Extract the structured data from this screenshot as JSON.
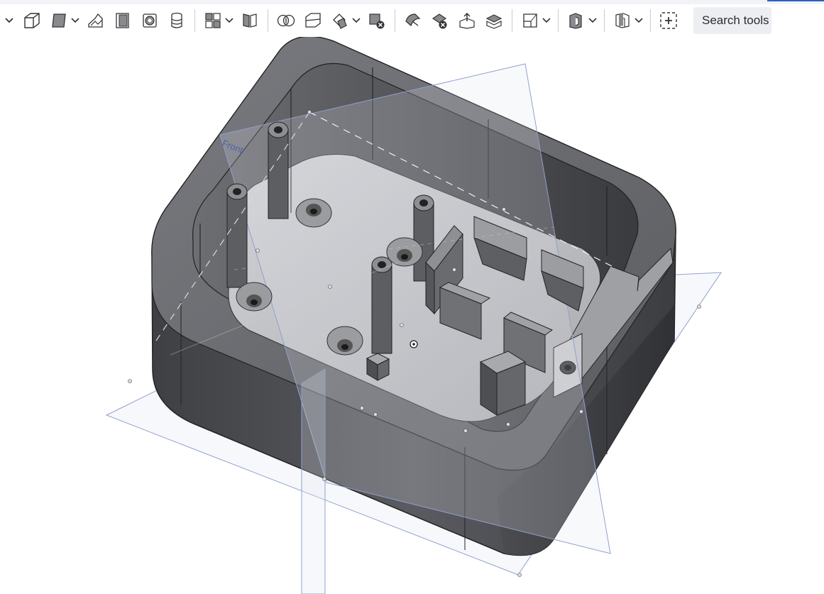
{
  "toolbar": {
    "tools": [
      {
        "icon": "chevron-down-icon"
      },
      {
        "icon": "extrude-icon"
      },
      {
        "icon": "revolve-icon",
        "has_dropdown": true
      },
      {
        "icon": "sweep-icon"
      },
      {
        "icon": "loft-icon"
      },
      {
        "icon": "thicken-icon"
      },
      {
        "icon": "enclose-icon"
      },
      {
        "icon": "fillet-icon",
        "has_dropdown": true
      },
      {
        "icon": "chamfer-icon"
      },
      {
        "icon": "boolean-icon"
      },
      {
        "icon": "split-icon"
      },
      {
        "icon": "transform-icon",
        "has_dropdown": true
      },
      {
        "icon": "delete-part-icon"
      },
      {
        "icon": "modify-fillet-icon"
      },
      {
        "icon": "delete-face-icon"
      },
      {
        "icon": "move-face-icon"
      },
      {
        "icon": "replace-face-icon"
      },
      {
        "icon": "plane-icon",
        "has_dropdown": true
      },
      {
        "icon": "mate-connector-icon",
        "has_dropdown": true
      },
      {
        "icon": "section-icon",
        "has_dropdown": true
      },
      {
        "icon": "add-custom-feature-icon"
      }
    ],
    "search_label": "Search tools"
  },
  "viewport": {
    "plane_label": "Front",
    "colors": {
      "body_dark": "#4a4a4e",
      "body_mid": "#6b6c70",
      "floor": "#c4c5c8",
      "plane_stroke": "#8fa0cc",
      "plane_fill": "#e4e7f1"
    }
  }
}
